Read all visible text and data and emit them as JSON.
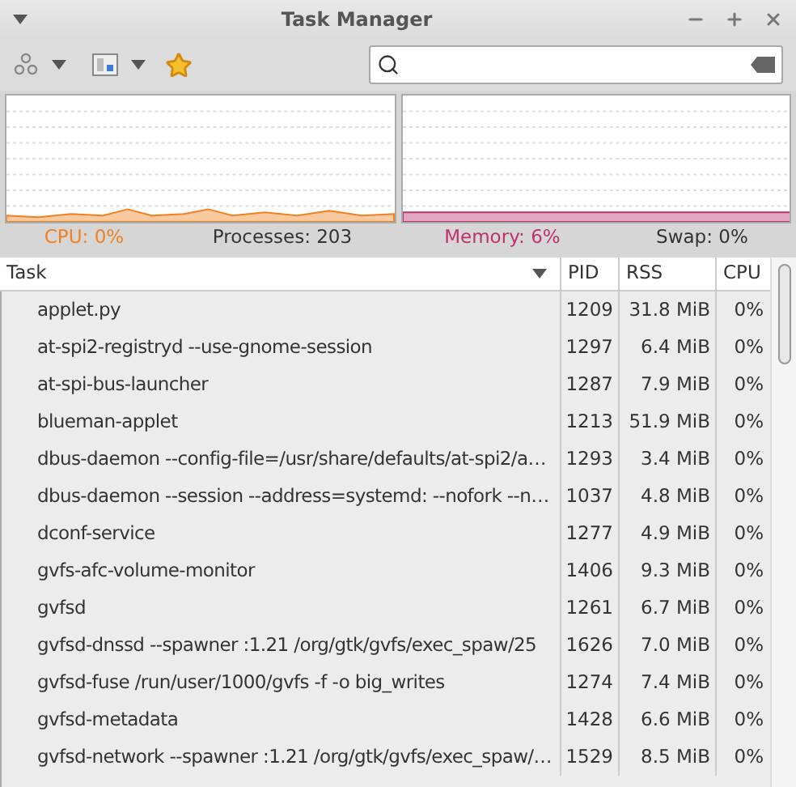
{
  "window": {
    "title": "Task Manager"
  },
  "status": {
    "cpu": "CPU: 0%",
    "processes": "Processes: 203",
    "memory": "Memory: 6%",
    "swap": "Swap: 0%"
  },
  "table": {
    "columns": [
      "Task",
      "PID",
      "RSS",
      "CPU"
    ],
    "rows": [
      {
        "task": "applet.py",
        "pid": "1209",
        "rss": "31.8 MiB",
        "cpu": "0%"
      },
      {
        "task": "at-spi2-registryd --use-gnome-session",
        "pid": "1297",
        "rss": "6.4 MiB",
        "cpu": "0%"
      },
      {
        "task": "at-spi-bus-launcher",
        "pid": "1287",
        "rss": "7.9 MiB",
        "cpu": "0%"
      },
      {
        "task": "blueman-applet",
        "pid": "1213",
        "rss": "51.9 MiB",
        "cpu": "0%"
      },
      {
        "task": "dbus-daemon --config-file=/usr/share/defaults/at-spi2/a…",
        "pid": "1293",
        "rss": "3.4 MiB",
        "cpu": "0%"
      },
      {
        "task": "dbus-daemon --session --address=systemd: --nofork --n…",
        "pid": "1037",
        "rss": "4.8 MiB",
        "cpu": "0%"
      },
      {
        "task": "dconf-service",
        "pid": "1277",
        "rss": "4.9 MiB",
        "cpu": "0%"
      },
      {
        "task": "gvfs-afc-volume-monitor",
        "pid": "1406",
        "rss": "9.3 MiB",
        "cpu": "0%"
      },
      {
        "task": "gvfsd",
        "pid": "1261",
        "rss": "6.7 MiB",
        "cpu": "0%"
      },
      {
        "task": "gvfsd-dnssd --spawner :1.21 /org/gtk/gvfs/exec_spaw/25",
        "pid": "1626",
        "rss": "7.0 MiB",
        "cpu": "0%"
      },
      {
        "task": "gvfsd-fuse /run/user/1000/gvfs -f -o big_writes",
        "pid": "1274",
        "rss": "7.4 MiB",
        "cpu": "0%"
      },
      {
        "task": "gvfsd-metadata",
        "pid": "1428",
        "rss": "6.6 MiB",
        "cpu": "0%"
      },
      {
        "task": "gvfsd-network --spawner :1.21 /org/gtk/gvfs/exec_spaw/…",
        "pid": "1529",
        "rss": "8.5 MiB",
        "cpu": "0%"
      }
    ]
  }
}
